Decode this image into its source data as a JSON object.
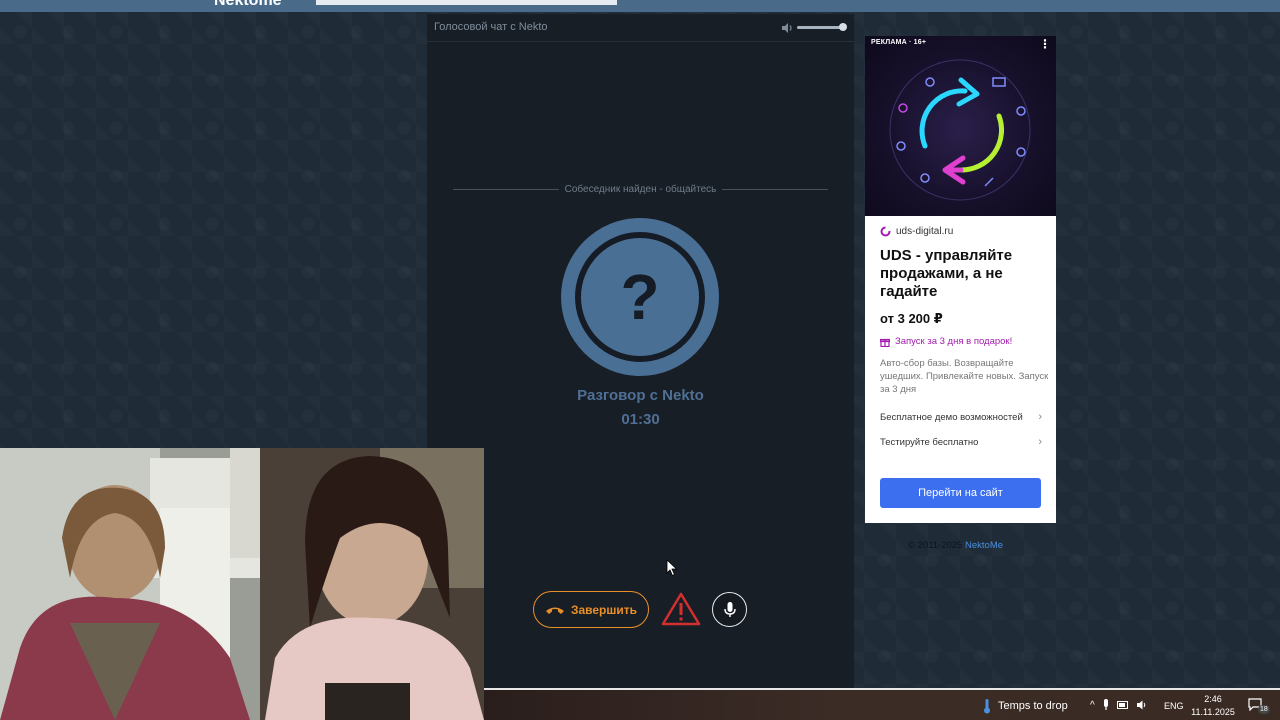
{
  "site": {
    "logo": "Nektome"
  },
  "chat": {
    "title": "Голосовой чат с Nekto",
    "volume_percent": 90,
    "status": "Собеседник найден - общайтесь",
    "avatar_symbol": "?",
    "partner": "Разговор с Nekto",
    "timer": "01:30",
    "end_button_label": "Завершить"
  },
  "ad": {
    "label": "РЕКЛАМА · 16+",
    "menu_symbol": "⋮",
    "domain": "uds-digital.ru",
    "headline": "UDS - управляйте продажами, а не гадайте",
    "price": "от 3 200 ₽",
    "promo": "Запуск за 3 дня в подарок!",
    "description": "Авто-сбор базы. Возвращайте ушедших. Привлекайте новых. Запуск за 3 дня",
    "links": [
      {
        "label": "Бесплатное демо возможностей",
        "chevron": "›"
      },
      {
        "label": "Тестируйте бесплатно",
        "chevron": "›"
      }
    ],
    "cta": "Перейти на сайт"
  },
  "footer": {
    "copyright": "© 2011-2025 ",
    "brand": "NektoMe"
  },
  "taskbar": {
    "weather": "Temps to drop",
    "tray_chevron": "^",
    "language": "ENG",
    "time": "2:46",
    "date": "11.11.2025",
    "notifications": "18"
  },
  "colors": {
    "accent_orange": "#e8902a",
    "avatar_blue": "#4a6f94",
    "cta_blue": "#3b6ff0",
    "promo_purple": "#a21caf",
    "report_red": "#d32f2f"
  }
}
